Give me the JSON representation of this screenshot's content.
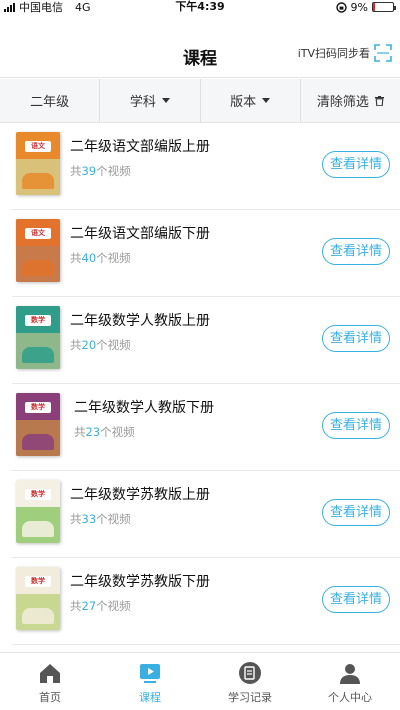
{
  "status": {
    "carrier": "中国电信",
    "network": "4G",
    "time": "下午4:39",
    "battery": "9%",
    "battery_level": 0.09,
    "battery_color": "#e3262d"
  },
  "header": {
    "title": "课程",
    "scan_label": "iTV扫码同步看"
  },
  "filters": [
    {
      "label": "二年级"
    },
    {
      "label": "学科"
    },
    {
      "label": "版本"
    },
    {
      "label": "清除筛选"
    }
  ],
  "courses": [
    {
      "title": "二年级语文部编版上册",
      "count_prefix": "共",
      "count": "39",
      "count_suffix": "个视频",
      "button": "查看详情",
      "cover_label": "语文",
      "cover_color": "#e8892b",
      "cover_bottom": "#d9c17a"
    },
    {
      "title": "二年级语文部编版下册",
      "count_prefix": "共",
      "count": "40",
      "count_suffix": "个视频",
      "button": "查看详情",
      "cover_label": "语文",
      "cover_color": "#e2722c",
      "cover_bottom": "#c97a4a"
    },
    {
      "title": "二年级数学人教版上册",
      "count_prefix": "共",
      "count": "20",
      "count_suffix": "个视频",
      "button": "查看详情",
      "cover_label": "数学",
      "cover_color": "#2f9d8a",
      "cover_bottom": "#8fb88a"
    },
    {
      "title": "二年级数学人教版下册",
      "count_prefix": "共",
      "count": "23",
      "count_suffix": "个视频",
      "button": "查看详情",
      "cover_label": "数学",
      "cover_color": "#8b3f7a",
      "cover_bottom": "#b9794f"
    },
    {
      "title": "二年级数学苏教版上册",
      "count_prefix": "共",
      "count": "33",
      "count_suffix": "个视频",
      "button": "查看详情",
      "cover_label": "数学",
      "cover_color": "#f4f1e4",
      "cover_bottom": "#9fcf7d"
    },
    {
      "title": "二年级数学苏教版下册",
      "count_prefix": "共",
      "count": "27",
      "count_suffix": "个视频",
      "button": "查看详情",
      "cover_label": "数学",
      "cover_color": "#f1ecdc",
      "cover_bottom": "#c8d890"
    }
  ],
  "tabs": [
    {
      "label": "首页",
      "icon": "home-icon"
    },
    {
      "label": "课程",
      "icon": "play-icon"
    },
    {
      "label": "学习记录",
      "icon": "record-icon"
    },
    {
      "label": "个人中心",
      "icon": "user-icon"
    }
  ],
  "colors": {
    "accent": "#3ab0e2",
    "muted": "#999999"
  }
}
